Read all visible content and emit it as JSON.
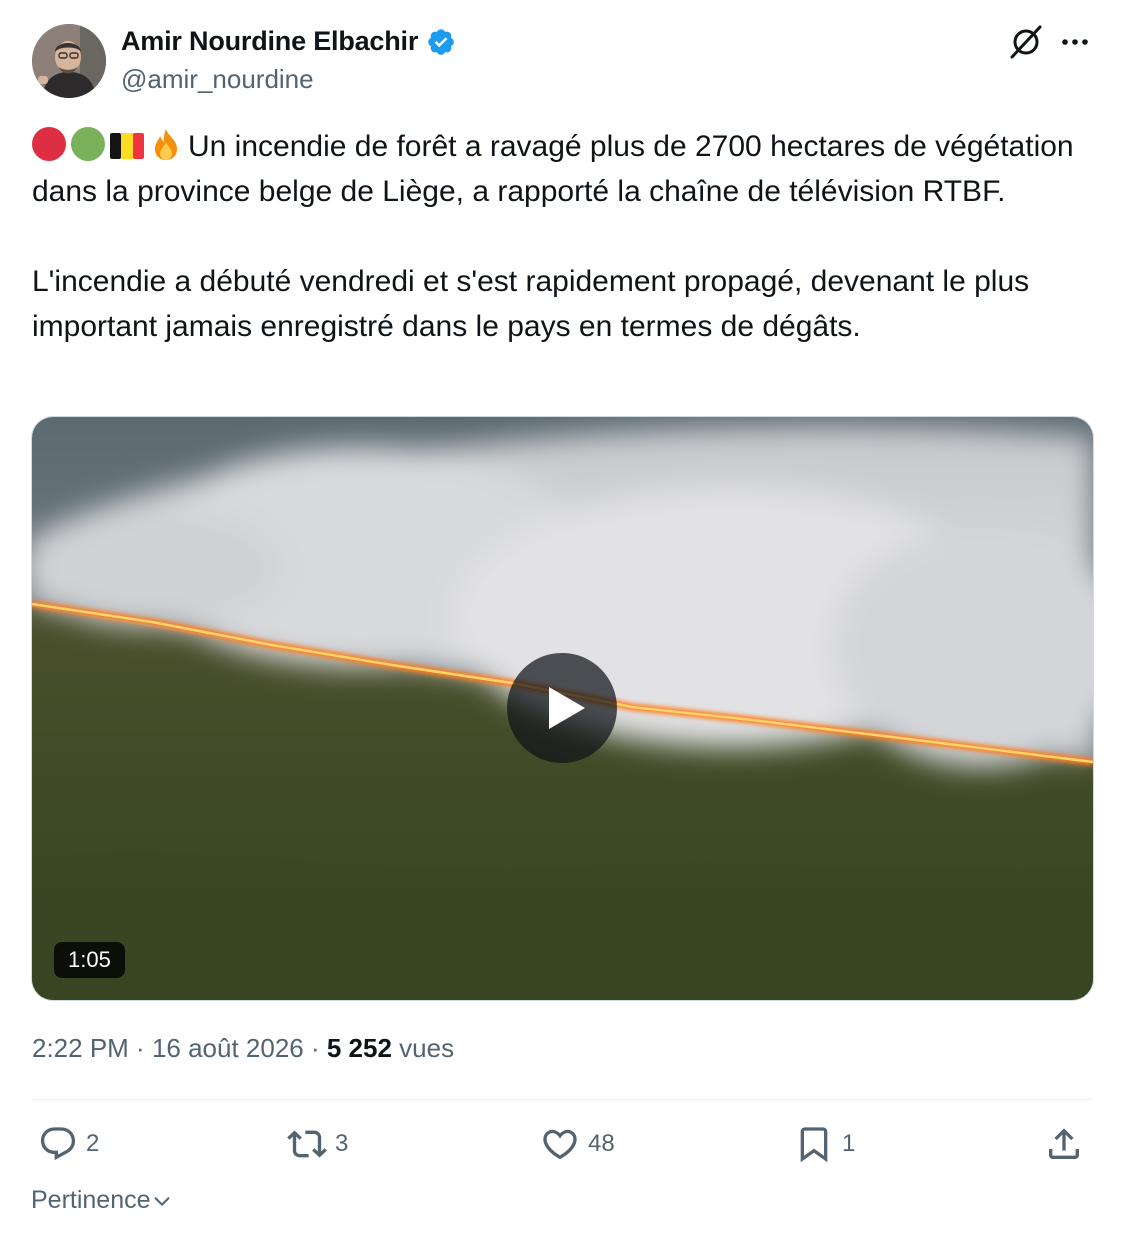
{
  "author": {
    "name": "Amir Nourdine Elbachir",
    "handle": "@amir_nourdine",
    "verified_color": "#1d9bf0"
  },
  "tweet": {
    "emojis": [
      "red-circle",
      "green-circle",
      "flag-belgium",
      "fire"
    ],
    "text": "Un incendie de forêt a ravagé plus de 2700 hectares de végétation dans la province belge de Liège, a rapporté la chaîne de télévision RTBF.\n\nL'incendie a débuté vendredi et s'est rapidement propagé, devenant le plus important jamais enregistré dans le pays en termes de dégâts."
  },
  "media": {
    "duration": "1:05"
  },
  "meta": {
    "time": "2:22 PM",
    "separator": " · ",
    "date": "16 août 2026",
    "views_count": "5 252",
    "views_label": "vues"
  },
  "actions": {
    "replies": "2",
    "reposts": "3",
    "likes": "48",
    "bookmarks": "1"
  },
  "sort": {
    "label": "Pertinence"
  }
}
